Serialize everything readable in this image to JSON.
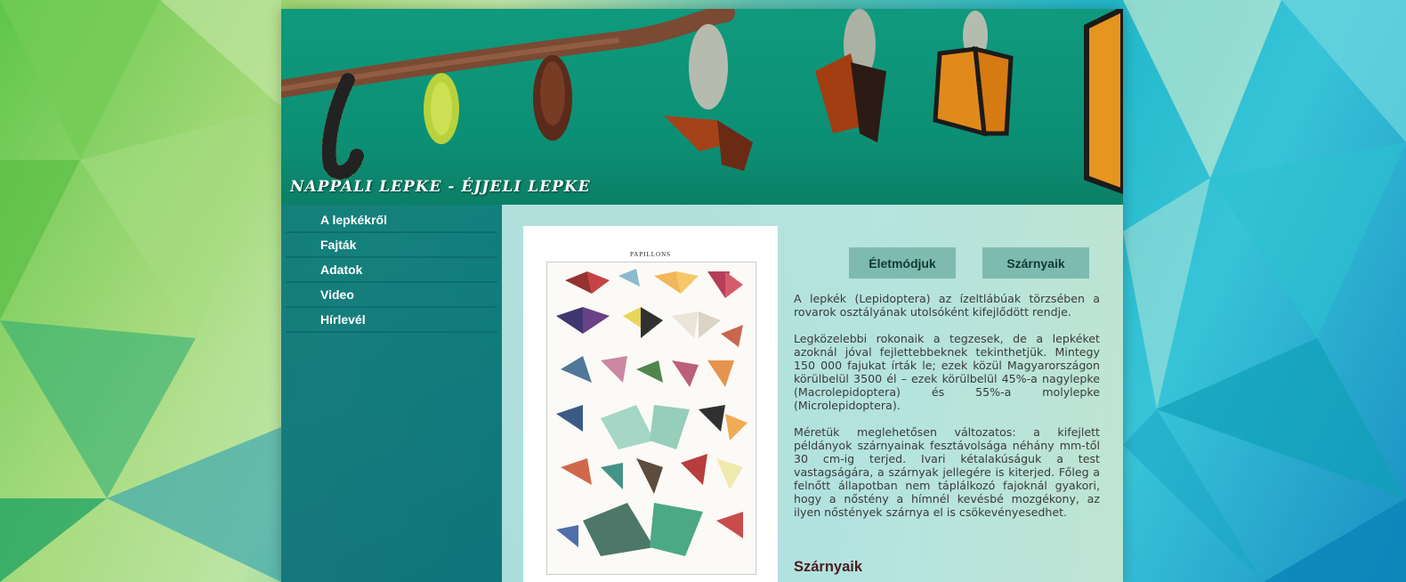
{
  "header": {
    "site_title": "NAPPALI LEPKE - ÉJJELI LEPKE"
  },
  "nav": {
    "items": [
      {
        "label": "A lepkékről"
      },
      {
        "label": "Fajták"
      },
      {
        "label": "Adatok"
      },
      {
        "label": "Video"
      },
      {
        "label": "Hírlevél"
      }
    ]
  },
  "poster": {
    "title": "PAPILLONS"
  },
  "tabs": [
    {
      "label": "Életmódjuk"
    },
    {
      "label": "Szárnyaik"
    }
  ],
  "article": {
    "paragraphs": [
      "A lepkék (Lepidoptera) az ízeltlábúak törzsében a rovarok osztályának utolsóként kifejlődött rendje.",
      "Legközelebbi rokonaik a tegzesek, de a lepkéket azoknál jóval fejlettebbeknek tekinthetjük. Mintegy 150 000 fajukat írták le; ezek közül Magyarországon körülbelül 3500 él – ezek körülbelül 45%-a nagylepke (Macrolepidoptera) és 55%-a molylepke (Microlepidoptera).",
      "Méretük meglehetősen változatos: a kifejlett példányok szárnyainak fesztávolsága néhány mm-től 30 cm-ig terjed. Ivari kétalakúságuk a test vastagságára, a szárnyak jellegére is kiterjed. Főleg a felnőtt állapotban nem táplálkozó fajoknál gyakori, hogy a nőstény a hímnél kevésbé mozgékony, az ilyen nőstények szárnya el is csökevényesedhet."
    ],
    "section_heading": "Szárnyaik"
  },
  "colors": {
    "header_bg": "#0f9a7e",
    "sidebar_bg": "#067878",
    "tab_bg": "#7fbab0",
    "heading": "#4a1d1d"
  }
}
